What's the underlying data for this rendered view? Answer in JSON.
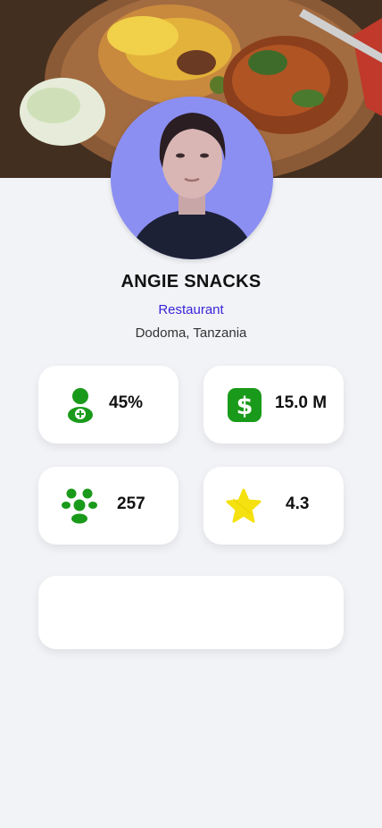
{
  "profile": {
    "name": "ANGIE SNACKS",
    "category": "Restaurant",
    "location": "Dodoma, Tanzania"
  },
  "stats": [
    {
      "icon": "add-user-icon",
      "value": "45%"
    },
    {
      "icon": "dollar-icon",
      "value": "15.0 M"
    },
    {
      "icon": "group-icon",
      "value": "257"
    },
    {
      "icon": "star-icon",
      "value": "4.3"
    }
  ],
  "colors": {
    "accent": "#3b24d8",
    "icon_green": "#1a9a1a",
    "star_yellow": "#f5e10f",
    "background": "#f2f3f7"
  }
}
